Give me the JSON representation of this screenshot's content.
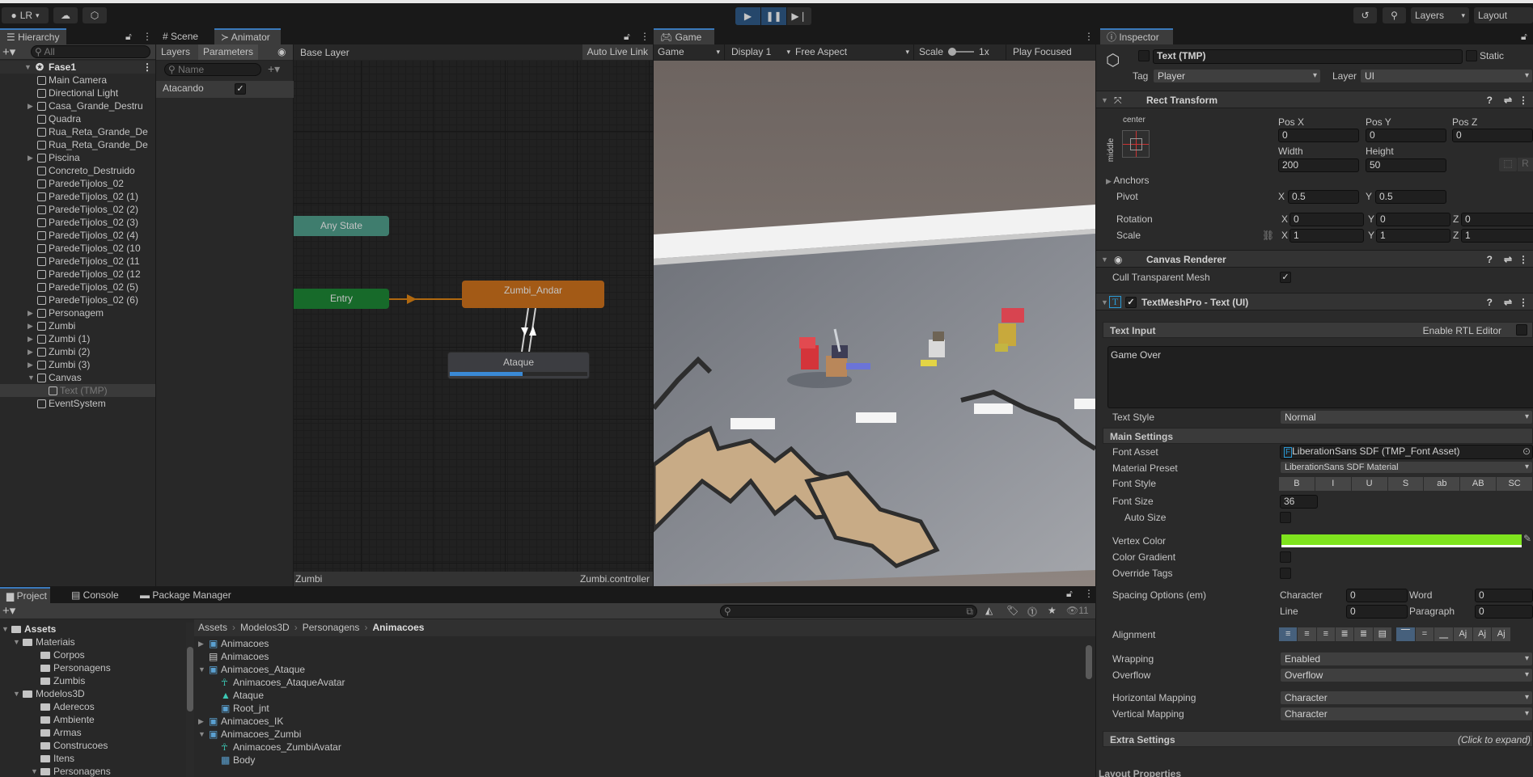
{
  "toolbar": {
    "account": "LR",
    "layers": "Layers",
    "layout": "Layout"
  },
  "hierarchy": {
    "tab": "Hierarchy",
    "search_placeholder": "All",
    "scene": "Fase1",
    "items": [
      {
        "label": "Main Camera",
        "depth": 1,
        "arrow": ""
      },
      {
        "label": "Directional Light",
        "depth": 1,
        "arrow": ""
      },
      {
        "label": "Casa_Grande_Destru",
        "depth": 1,
        "arrow": "right"
      },
      {
        "label": "Quadra",
        "depth": 1,
        "arrow": ""
      },
      {
        "label": "Rua_Reta_Grande_De",
        "depth": 1,
        "arrow": ""
      },
      {
        "label": "Rua_Reta_Grande_De",
        "depth": 1,
        "arrow": ""
      },
      {
        "label": "Piscina",
        "depth": 1,
        "arrow": "right"
      },
      {
        "label": "Concreto_Destruido",
        "depth": 1,
        "arrow": ""
      },
      {
        "label": "ParedeTijolos_02",
        "depth": 1,
        "arrow": ""
      },
      {
        "label": "ParedeTijolos_02 (1)",
        "depth": 1,
        "arrow": ""
      },
      {
        "label": "ParedeTijolos_02 (2)",
        "depth": 1,
        "arrow": ""
      },
      {
        "label": "ParedeTijolos_02 (3)",
        "depth": 1,
        "arrow": ""
      },
      {
        "label": "ParedeTijolos_02 (4)",
        "depth": 1,
        "arrow": ""
      },
      {
        "label": "ParedeTijolos_02 (10",
        "depth": 1,
        "arrow": ""
      },
      {
        "label": "ParedeTijolos_02 (11",
        "depth": 1,
        "arrow": ""
      },
      {
        "label": "ParedeTijolos_02 (12",
        "depth": 1,
        "arrow": ""
      },
      {
        "label": "ParedeTijolos_02 (5)",
        "depth": 1,
        "arrow": ""
      },
      {
        "label": "ParedeTijolos_02 (6)",
        "depth": 1,
        "arrow": ""
      },
      {
        "label": "Personagem",
        "depth": 1,
        "arrow": "right"
      },
      {
        "label": "Zumbi",
        "depth": 1,
        "arrow": "right"
      },
      {
        "label": "Zumbi (1)",
        "depth": 1,
        "arrow": "right"
      },
      {
        "label": "Zumbi (2)",
        "depth": 1,
        "arrow": "right"
      },
      {
        "label": "Zumbi (3)",
        "depth": 1,
        "arrow": "right"
      },
      {
        "label": "Canvas",
        "depth": 1,
        "arrow": "down"
      },
      {
        "label": "Text (TMP)",
        "depth": 2,
        "arrow": "",
        "selected": true
      },
      {
        "label": "EventSystem",
        "depth": 1,
        "arrow": ""
      }
    ]
  },
  "animator": {
    "tabs": [
      "Scene",
      "Animator"
    ],
    "sub_tabs": [
      "Layers",
      "Parameters"
    ],
    "param_search_placeholder": "Name",
    "parameters": [
      {
        "name": "Atacando",
        "value": true
      }
    ],
    "breadcrumb": "Base Layer",
    "auto_live_link": "Auto Live Link",
    "states": {
      "any": "Any State",
      "entry": "Entry",
      "default": "Zumbi_Andar",
      "active": "Ataque"
    },
    "active_progress": 0.53,
    "footer_left": "Zumbi",
    "footer_right": "Zumbi.controller",
    "colors": {
      "any": "#3f7d6e",
      "entry": "#176a2a",
      "default": "#a35a16",
      "active_bar": "#3a8ad6"
    }
  },
  "game": {
    "tab": "Game",
    "mode": "Game",
    "display": "Display 1",
    "aspect": "Free Aspect",
    "scale_label": "Scale",
    "scale_value": "1x",
    "play_focused": "Play Focused"
  },
  "inspector": {
    "tab": "Inspector",
    "object_name": "Text (TMP)",
    "static_label": "Static",
    "tag_label": "Tag",
    "tag": "Player",
    "layer_label": "Layer",
    "layer": "UI",
    "rect": {
      "title": "Rect Transform",
      "anchor_h": "center",
      "anchor_v": "middle",
      "pos_labels": [
        "Pos X",
        "Pos Y",
        "Pos Z"
      ],
      "pos": [
        "0",
        "0",
        "0"
      ],
      "size_labels": [
        "Width",
        "Height"
      ],
      "size": [
        "200",
        "50"
      ],
      "anchors": "Anchors",
      "pivot_label": "Pivot",
      "pivot": [
        "0.5",
        "0.5"
      ],
      "rotation_label": "Rotation",
      "rotation": [
        "0",
        "0",
        "0"
      ],
      "scale_label": "Scale",
      "scale": [
        "1",
        "1",
        "1"
      ],
      "axes": [
        "X",
        "Y",
        "Z"
      ],
      "r_button": "R"
    },
    "canvas_renderer": {
      "title": "Canvas Renderer",
      "cull_label": "Cull Transparent Mesh",
      "cull": true
    },
    "tmp": {
      "title": "TextMeshPro - Text (UI)",
      "enabled": true,
      "text_input": "Text Input",
      "rtl_label": "Enable RTL Editor",
      "text": "Game Over",
      "text_style_label": "Text Style",
      "text_style": "Normal",
      "main_settings": "Main Settings",
      "font_asset_label": "Font Asset",
      "font_asset": "LiberationSans SDF (TMP_Font Asset)",
      "material_label": "Material Preset",
      "material": "LiberationSans SDF Material",
      "font_style_label": "Font Style",
      "font_styles": [
        "B",
        "I",
        "U",
        "S",
        "ab",
        "AB",
        "SC"
      ],
      "font_size_label": "Font Size",
      "font_size": "36",
      "auto_size_label": "Auto Size",
      "vertex_color_label": "Vertex Color",
      "vertex_color": "#7fe41e",
      "gradient_label": "Color Gradient",
      "override_label": "Override Tags",
      "spacing_label": "Spacing Options (em)",
      "spacing": {
        "character_label": "Character",
        "character": "0",
        "word_label": "Word",
        "word": "0",
        "line_label": "Line",
        "line": "0",
        "paragraph_label": "Paragraph",
        "paragraph": "0"
      },
      "alignment_label": "Alignment",
      "wrapping_label": "Wrapping",
      "wrapping": "Enabled",
      "overflow_label": "Overflow",
      "overflow": "Overflow",
      "hmap_label": "Horizontal Mapping",
      "hmap": "Character",
      "vmap_label": "Vertical Mapping",
      "vmap": "Character",
      "extra": "Extra Settings",
      "extra_hint": "(Click to expand)",
      "layout_props": "Layout Properties"
    }
  },
  "project": {
    "tabs": [
      "Project",
      "Console",
      "Package Manager"
    ],
    "tree": [
      {
        "label": "Assets",
        "depth": 0,
        "arrow": "down",
        "bold": true
      },
      {
        "label": "Materiais",
        "depth": 1,
        "arrow": "down"
      },
      {
        "label": "Corpos",
        "depth": 2,
        "arrow": ""
      },
      {
        "label": "Personagens",
        "depth": 2,
        "arrow": ""
      },
      {
        "label": "Zumbis",
        "depth": 2,
        "arrow": ""
      },
      {
        "label": "Modelos3D",
        "depth": 1,
        "arrow": "down"
      },
      {
        "label": "Aderecos",
        "depth": 2,
        "arrow": ""
      },
      {
        "label": "Ambiente",
        "depth": 2,
        "arrow": ""
      },
      {
        "label": "Armas",
        "depth": 2,
        "arrow": ""
      },
      {
        "label": "Construcoes",
        "depth": 2,
        "arrow": ""
      },
      {
        "label": "Itens",
        "depth": 2,
        "arrow": ""
      },
      {
        "label": "Personagens",
        "depth": 2,
        "arrow": "down"
      }
    ],
    "breadcrumb": [
      "Assets",
      "Modelos3D",
      "Personagens",
      "Animacoes"
    ],
    "files": [
      {
        "label": "Animacoes",
        "depth": 0,
        "icon": "model",
        "arrow": "right"
      },
      {
        "label": "Animacoes",
        "depth": 0,
        "icon": "file",
        "arrow": ""
      },
      {
        "label": "Animacoes_Ataque",
        "depth": 0,
        "icon": "model",
        "arrow": "down"
      },
      {
        "label": "Animacoes_AtaqueAvatar",
        "depth": 1,
        "icon": "avatar",
        "arrow": ""
      },
      {
        "label": "Ataque",
        "depth": 1,
        "icon": "clip",
        "arrow": ""
      },
      {
        "label": "Root_jnt",
        "depth": 1,
        "icon": "model",
        "arrow": ""
      },
      {
        "label": "Animacoes_IK",
        "depth": 0,
        "icon": "model",
        "arrow": "right"
      },
      {
        "label": "Animacoes_Zumbi",
        "depth": 0,
        "icon": "model",
        "arrow": "down"
      },
      {
        "label": "Animacoes_ZumbiAvatar",
        "depth": 1,
        "icon": "avatar",
        "arrow": ""
      },
      {
        "label": "Body",
        "depth": 1,
        "icon": "mesh",
        "arrow": ""
      }
    ],
    "hidden_count": "11"
  }
}
